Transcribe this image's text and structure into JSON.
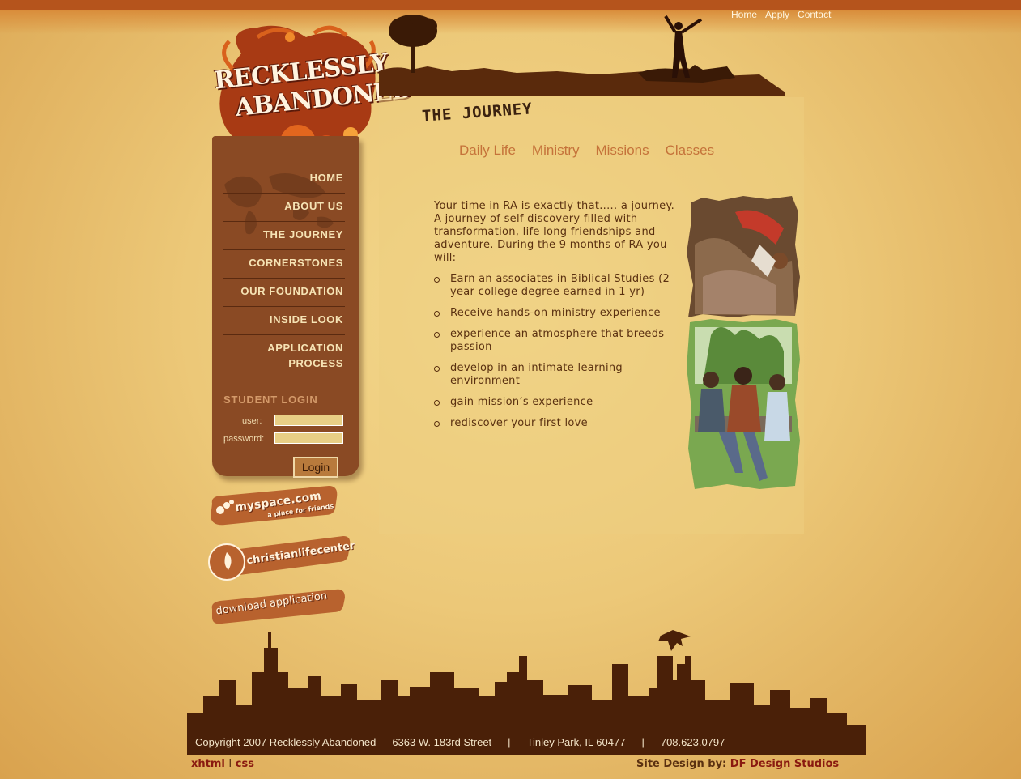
{
  "top_links": [
    "Home",
    "Apply",
    "Contact"
  ],
  "logo": {
    "line1": "RECKLESSLY",
    "line2": "ABANDONED"
  },
  "page_title": "THE JOURNEY",
  "subnav": [
    "Daily Life",
    "Ministry",
    "Missions",
    "Classes"
  ],
  "intro": "Your time in RA is exactly that..... a journey. A journey of self discovery filled with transformation, life long friendships and adventure. During the 9 months of RA you will:",
  "bullets": [
    "Earn an associates in Biblical Studies (2 year college degree earned in 1 yr)",
    "Receive hands-on ministry experience",
    "experience an atmosphere that breeds passion",
    "develop in an intimate learning environment",
    "gain mission’s experience",
    "rediscover your first love"
  ],
  "nav": [
    "HOME",
    "ABOUT US",
    "THE JOURNEY",
    "CORNERSTONES",
    "OUR FOUNDATION",
    "INSIDE LOOK",
    "APPLICATION",
    "PROCESS"
  ],
  "login": {
    "heading": "STUDENT LOGIN",
    "user_label": "user:",
    "password_label": "password:",
    "button": "Login"
  },
  "badges": {
    "myspace": "myspace.com",
    "myspace_tag": "a place for friends",
    "clc": "christianlifecenter",
    "download": "download application"
  },
  "footer": {
    "copyright": "Copyright 2007 Recklessly Abandoned",
    "address": "6363 W. 183rd Street",
    "city": "Tinley Park, IL 60477",
    "phone": "708.623.0797",
    "sep": "|"
  },
  "bottom": {
    "xhtml": "xhtml",
    "pipe": "I",
    "css": "css",
    "credit_label": "Site Design by:",
    "credit_name": "DF Design Studios"
  },
  "colors": {
    "nav_bg": "#8a4a24",
    "accent": "#c5733a",
    "text": "#5a3010",
    "link_red": "#8a1a10"
  }
}
